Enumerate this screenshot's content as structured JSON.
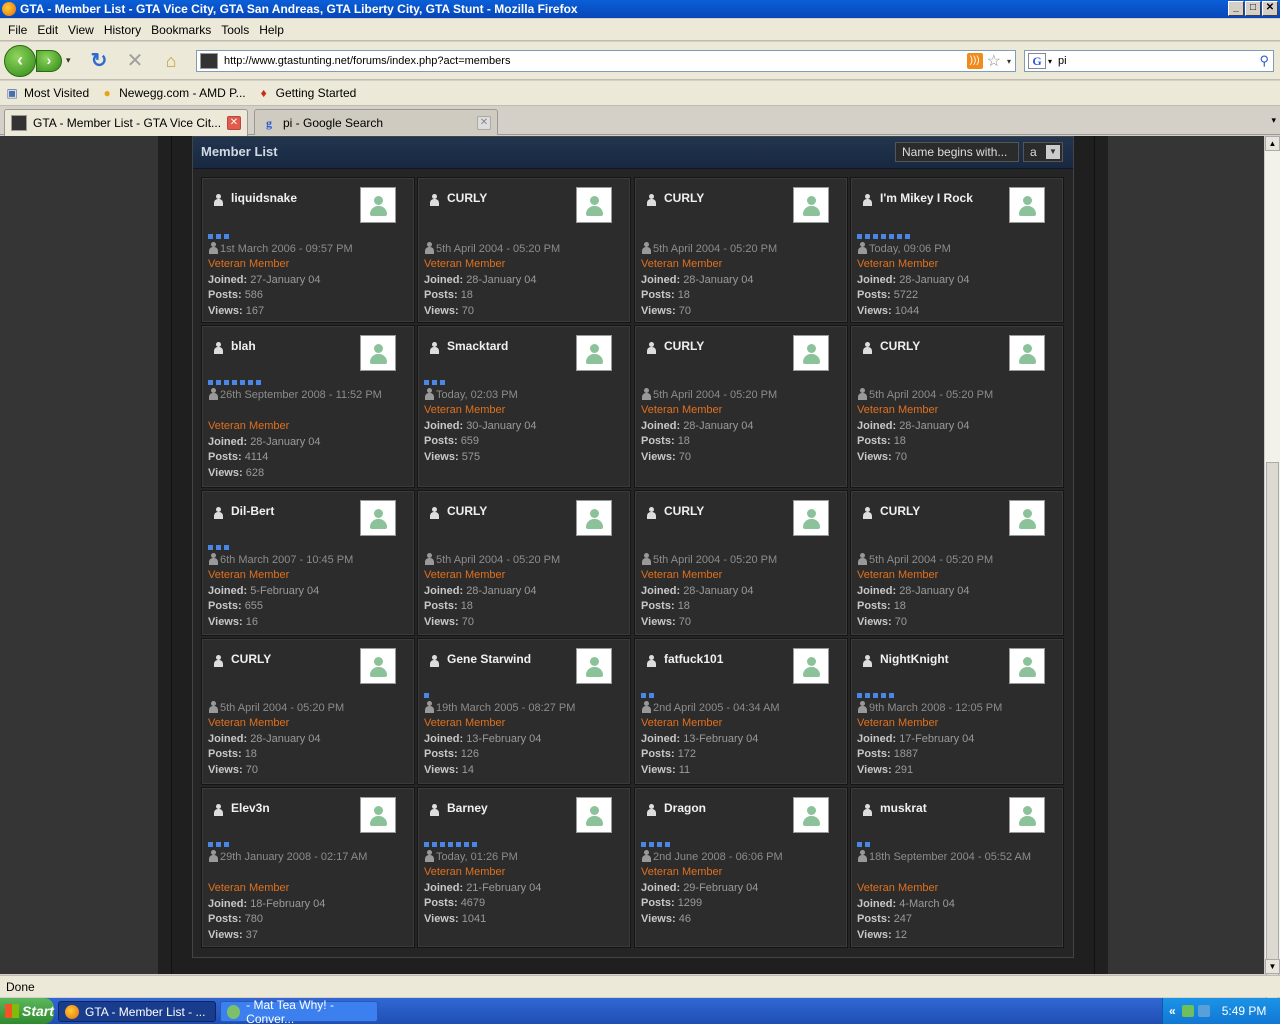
{
  "window": {
    "title": "GTA - Member List - GTA Vice City, GTA San Andreas, GTA Liberty City, GTA Stunt - Mozilla Firefox",
    "btn_min": "_",
    "btn_max": "□",
    "btn_close": "✕"
  },
  "menu": [
    "File",
    "Edit",
    "View",
    "History",
    "Bookmarks",
    "Tools",
    "Help"
  ],
  "nav": {
    "back": "‹",
    "forward": "›",
    "history_dropdown": "▾",
    "reload": "↻",
    "stop": "✕",
    "home": "⌂",
    "url": "http://www.gtastunting.net/forums/index.php?act=members",
    "rss": ")))",
    "star": "☆",
    "url_dropdown": "▾",
    "search_engine": "G",
    "search_dropdown": "▾",
    "search_value": "pi",
    "search_icon": "⚲"
  },
  "bookmarks": [
    {
      "label": "Most Visited",
      "icon": "bookmark-folder-icon",
      "glyph": "▣",
      "color": "#4a6fb0"
    },
    {
      "label": "Newegg.com - AMD P...",
      "icon": "newegg-icon",
      "glyph": "●",
      "color": "#e8a317"
    },
    {
      "label": "Getting Started",
      "icon": "firefox-icon",
      "glyph": "♦",
      "color": "#cc2b1a"
    }
  ],
  "tabs": [
    {
      "label": "GTA - Member List - GTA Vice Cit...",
      "close": "✕",
      "icon": "site-favicon"
    },
    {
      "label": "pi - Google Search",
      "close": "✕",
      "icon": "google-favicon"
    }
  ],
  "tab_list_btn": "▾",
  "panel": {
    "title": "Member List",
    "filter_label": "Name begins with...",
    "filter_letter": "a",
    "letter_arrow": "▼"
  },
  "members": [
    {
      "name": "liquidsnake",
      "pips": 3,
      "last": "1st March 2006 - 09:57 PM",
      "group": "Veteran Member",
      "joined": "27-January 04",
      "posts": "586",
      "views": "167"
    },
    {
      "name": "CURLY",
      "pips": 0,
      "last": "5th April 2004 - 05:20 PM",
      "group": "Veteran Member",
      "joined": "28-January 04",
      "posts": "18",
      "views": "70"
    },
    {
      "name": "CURLY",
      "pips": 0,
      "last": "5th April 2004 - 05:20 PM",
      "group": "Veteran Member",
      "joined": "28-January 04",
      "posts": "18",
      "views": "70"
    },
    {
      "name": "I'm Mikey I Rock",
      "pips": 7,
      "last": "Today, 09:06 PM",
      "group": "Veteran Member",
      "joined": "28-January 04",
      "posts": "5722",
      "views": "1044"
    },
    {
      "name": "blah",
      "pips": 7,
      "last": "26th September 2008 - 11:52 PM",
      "group": "Veteran Member",
      "joined": "28-January 04",
      "posts": "4114",
      "views": "628"
    },
    {
      "name": "Smacktard",
      "pips": 3,
      "last": "Today, 02:03 PM",
      "group": "Veteran Member",
      "joined": "30-January 04",
      "posts": "659",
      "views": "575"
    },
    {
      "name": "CURLY",
      "pips": 0,
      "last": "5th April 2004 - 05:20 PM",
      "group": "Veteran Member",
      "joined": "28-January 04",
      "posts": "18",
      "views": "70"
    },
    {
      "name": "CURLY",
      "pips": 0,
      "last": "5th April 2004 - 05:20 PM",
      "group": "Veteran Member",
      "joined": "28-January 04",
      "posts": "18",
      "views": "70"
    },
    {
      "name": "Dil-Bert",
      "pips": 3,
      "last": "6th March 2007 - 10:45 PM",
      "group": "Veteran Member",
      "joined": "5-February 04",
      "posts": "655",
      "views": "16"
    },
    {
      "name": "CURLY",
      "pips": 0,
      "last": "5th April 2004 - 05:20 PM",
      "group": "Veteran Member",
      "joined": "28-January 04",
      "posts": "18",
      "views": "70"
    },
    {
      "name": "CURLY",
      "pips": 0,
      "last": "5th April 2004 - 05:20 PM",
      "group": "Veteran Member",
      "joined": "28-January 04",
      "posts": "18",
      "views": "70"
    },
    {
      "name": "CURLY",
      "pips": 0,
      "last": "5th April 2004 - 05:20 PM",
      "group": "Veteran Member",
      "joined": "28-January 04",
      "posts": "18",
      "views": "70"
    },
    {
      "name": "CURLY",
      "pips": 0,
      "last": "5th April 2004 - 05:20 PM",
      "group": "Veteran Member",
      "joined": "28-January 04",
      "posts": "18",
      "views": "70"
    },
    {
      "name": "Gene Starwind",
      "pips": 1,
      "last": "19th March 2005 - 08:27 PM",
      "group": "Veteran Member",
      "joined": "13-February 04",
      "posts": "126",
      "views": "14"
    },
    {
      "name": "fatfuck101",
      "pips": 2,
      "last": "2nd April 2005 - 04:34 AM",
      "group": "Veteran Member",
      "joined": "13-February 04",
      "posts": "172",
      "views": "11"
    },
    {
      "name": "NightKnight",
      "pips": 5,
      "last": "9th March 2008 - 12:05 PM",
      "group": "Veteran Member",
      "joined": "17-February 04",
      "posts": "1887",
      "views": "291"
    },
    {
      "name": "Elev3n",
      "pips": 3,
      "last": "29th January 2008 - 02:17 AM",
      "group": "Veteran Member",
      "joined": "18-February 04",
      "posts": "780",
      "views": "37"
    },
    {
      "name": "Barney",
      "pips": 7,
      "last": "Today, 01:26 PM",
      "group": "Veteran Member",
      "joined": "21-February 04",
      "posts": "4679",
      "views": "1041"
    },
    {
      "name": "Dragon",
      "pips": 4,
      "last": "2nd June 2008 - 06:06 PM",
      "group": "Veteran Member",
      "joined": "29-February 04",
      "posts": "1299",
      "views": "46"
    },
    {
      "name": "muskrat",
      "pips": 2,
      "last": "18th September 2004 - 05:52 AM",
      "group": "Veteran Member",
      "joined": "4-March 04",
      "posts": "247",
      "views": "12"
    }
  ],
  "labels": {
    "joined": "Joined:",
    "posts": "Posts:",
    "views": "Views:"
  },
  "colors": {
    "group": "#e0701e",
    "pip": "#4a86e8",
    "header": "#1e2f48"
  },
  "status": "Done",
  "scroll": {
    "up": "▲",
    "down": "▼"
  },
  "taskbar": {
    "start": "Start",
    "tasks": [
      "GTA - Member List - ...",
      "- Mat Tea Why! - Conver..."
    ],
    "tray_chevron": "«",
    "clock": "5:49 PM"
  }
}
